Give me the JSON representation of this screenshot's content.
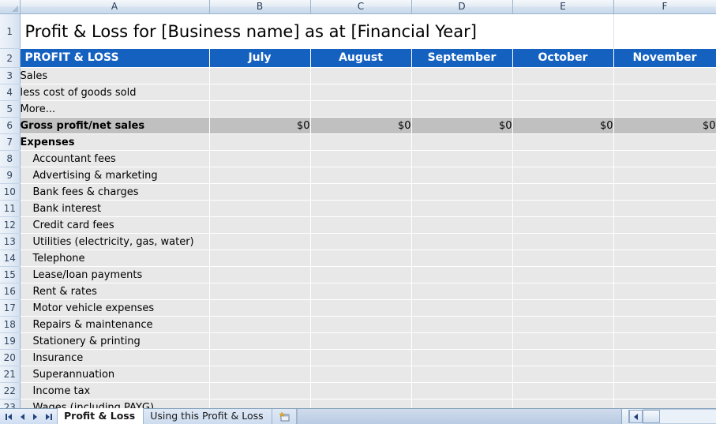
{
  "window": {
    "title": "Profit & Loss for [Business name] as at [Financial Year]"
  },
  "grid": {
    "column_headers": [
      "A",
      "B",
      "C",
      "D",
      "E",
      "F"
    ],
    "row_numbers": [
      "1",
      "2",
      "3",
      "4",
      "5",
      "6",
      "7",
      "8",
      "9",
      "10",
      "11",
      "12",
      "13",
      "14",
      "15",
      "16",
      "17",
      "18",
      "19",
      "20",
      "21",
      "22",
      "23"
    ],
    "title_row": {
      "row_number": "1",
      "text": "Profit & Loss for [Business name] as at [Financial Year]"
    },
    "header_row": {
      "row_number": "2",
      "label": "PROFIT & LOSS",
      "months": [
        "July",
        "August",
        "September",
        "October",
        "November"
      ],
      "fill_color": "#1561c0",
      "text_color": "#ffffff"
    },
    "rows": [
      {
        "row_number": "3",
        "label": "Sales",
        "indent": false,
        "bold": false,
        "style": "normal",
        "values": [
          "",
          "",
          "",
          "",
          ""
        ]
      },
      {
        "row_number": "4",
        "label": "less cost of goods sold",
        "indent": false,
        "bold": false,
        "style": "normal",
        "values": [
          "",
          "",
          "",
          "",
          ""
        ]
      },
      {
        "row_number": "5",
        "label": "More...",
        "indent": false,
        "bold": false,
        "style": "normal",
        "values": [
          "",
          "",
          "",
          "",
          ""
        ]
      },
      {
        "row_number": "6",
        "label": "Gross profit/net sales",
        "indent": false,
        "bold": true,
        "style": "total",
        "values": [
          "$0",
          "$0",
          "$0",
          "$0",
          "$0"
        ]
      },
      {
        "row_number": "7",
        "label": "Expenses",
        "indent": false,
        "bold": true,
        "style": "section",
        "values": [
          "",
          "",
          "",
          "",
          ""
        ]
      },
      {
        "row_number": "8",
        "label": "Accountant fees",
        "indent": true,
        "bold": false,
        "style": "normal",
        "values": [
          "",
          "",
          "",
          "",
          ""
        ]
      },
      {
        "row_number": "9",
        "label": "Advertising & marketing",
        "indent": true,
        "bold": false,
        "style": "normal",
        "values": [
          "",
          "",
          "",
          "",
          ""
        ]
      },
      {
        "row_number": "10",
        "label": "Bank fees & charges",
        "indent": true,
        "bold": false,
        "style": "normal",
        "values": [
          "",
          "",
          "",
          "",
          ""
        ]
      },
      {
        "row_number": "11",
        "label": "Bank interest",
        "indent": true,
        "bold": false,
        "style": "normal",
        "values": [
          "",
          "",
          "",
          "",
          ""
        ]
      },
      {
        "row_number": "12",
        "label": "Credit card fees",
        "indent": true,
        "bold": false,
        "style": "normal",
        "values": [
          "",
          "",
          "",
          "",
          ""
        ]
      },
      {
        "row_number": "13",
        "label": "Utilities (electricity, gas, water)",
        "indent": true,
        "bold": false,
        "style": "normal",
        "values": [
          "",
          "",
          "",
          "",
          ""
        ]
      },
      {
        "row_number": "14",
        "label": "Telephone",
        "indent": true,
        "bold": false,
        "style": "normal",
        "values": [
          "",
          "",
          "",
          "",
          ""
        ]
      },
      {
        "row_number": "15",
        "label": "Lease/loan payments",
        "indent": true,
        "bold": false,
        "style": "normal",
        "values": [
          "",
          "",
          "",
          "",
          ""
        ]
      },
      {
        "row_number": "16",
        "label": "Rent & rates",
        "indent": true,
        "bold": false,
        "style": "normal",
        "values": [
          "",
          "",
          "",
          "",
          ""
        ]
      },
      {
        "row_number": "17",
        "label": "Motor vehicle expenses",
        "indent": true,
        "bold": false,
        "style": "normal",
        "values": [
          "",
          "",
          "",
          "",
          ""
        ]
      },
      {
        "row_number": "18",
        "label": "Repairs & maintenance",
        "indent": true,
        "bold": false,
        "style": "normal",
        "values": [
          "",
          "",
          "",
          "",
          ""
        ]
      },
      {
        "row_number": "19",
        "label": "Stationery & printing",
        "indent": true,
        "bold": false,
        "style": "normal",
        "values": [
          "",
          "",
          "",
          "",
          ""
        ]
      },
      {
        "row_number": "20",
        "label": "Insurance",
        "indent": true,
        "bold": false,
        "style": "normal",
        "values": [
          "",
          "",
          "",
          "",
          ""
        ]
      },
      {
        "row_number": "21",
        "label": "Superannuation",
        "indent": true,
        "bold": false,
        "style": "normal",
        "values": [
          "",
          "",
          "",
          "",
          ""
        ]
      },
      {
        "row_number": "22",
        "label": "Income tax",
        "indent": true,
        "bold": false,
        "style": "normal",
        "values": [
          "",
          "",
          "",
          "",
          ""
        ]
      },
      {
        "row_number": "23",
        "label": "Wages (including PAYG)",
        "indent": true,
        "bold": false,
        "style": "clipped",
        "values": [
          "",
          "",
          "",
          "",
          ""
        ]
      }
    ]
  },
  "tab_bar": {
    "nav_buttons": [
      "first-sheet",
      "previous-sheet",
      "next-sheet",
      "last-sheet"
    ],
    "sheets": [
      {
        "name": "Profit & Loss",
        "active": true
      },
      {
        "name": "Using this Profit & Loss",
        "active": false
      }
    ],
    "insert_sheet_label": ""
  }
}
